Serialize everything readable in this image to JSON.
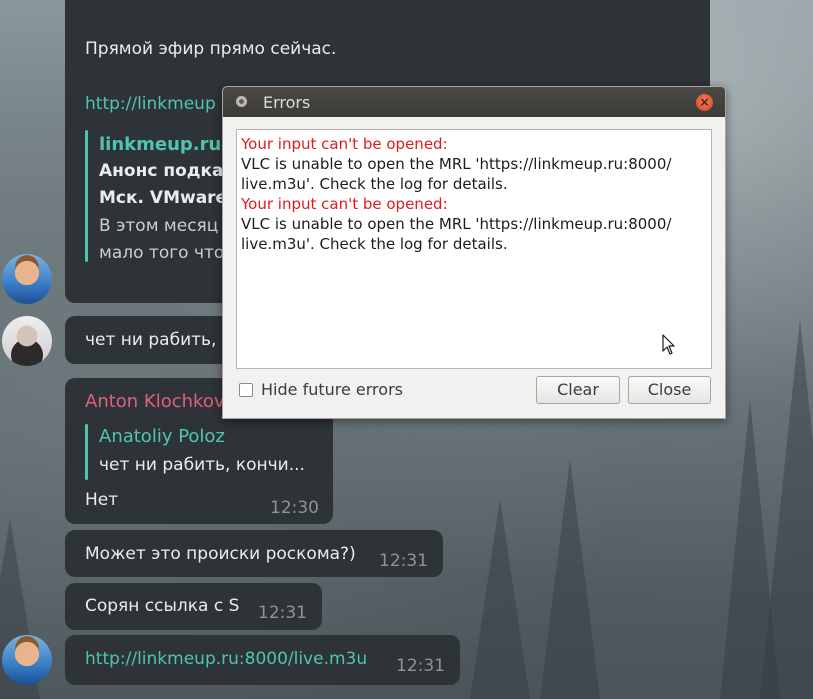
{
  "chat": {
    "top_text": "Прямой эфир прямо сейчас.",
    "top_link": "http://linkmeup",
    "preview_site": "linkmeup.ru",
    "preview_title_1": "Анонс подкас",
    "preview_title_2": "Мск. VMware",
    "preview_desc_1": "В этом месяц",
    "preview_desc_2": "мало того что",
    "msg_chet": "чет ни рабить,",
    "reply_sender": "Anton Klochkov",
    "reply_quote_name": "Anatoliy Poloz",
    "reply_quote_text": "чет ни рабить, кончи...",
    "reply_text": "Нет",
    "reply_time": "12:30",
    "msg_roskom": "Может это происки роскома?)",
    "msg_roskom_time": "12:31",
    "msg_s": "Сорян ссылка с S",
    "msg_s_time": "12:31",
    "msg_link": "http://linkmeup.ru:8000/live.m3u",
    "msg_link_time": "12:31"
  },
  "dialog": {
    "title": "Errors",
    "close_glyph": "×",
    "errors": [
      {
        "heading": "Your input can't be opened:",
        "line1": "VLC is unable to open the MRL 'https://linkmeup.ru:8000/",
        "line2": "live.m3u'. Check the log for details."
      },
      {
        "heading": "Your input can't be opened:",
        "line1": "VLC is unable to open the MRL 'https://linkmeup.ru:8000/",
        "line2": "live.m3u'. Check the log for details."
      }
    ],
    "hide_label": "Hide future errors",
    "hide_checked": false,
    "clear_label": "Clear",
    "close_label": "Close"
  },
  "colors": {
    "link": "#4fc5b0",
    "sender": "#e0607c",
    "error": "#e01b1b",
    "bubble": "#2e3338"
  }
}
